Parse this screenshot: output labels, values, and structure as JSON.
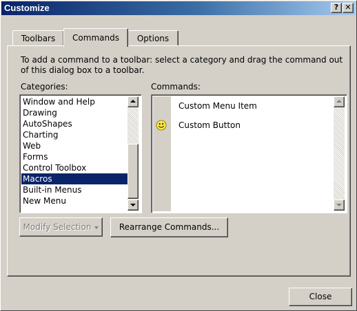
{
  "window": {
    "title": "Customize"
  },
  "titlebar_buttons": {
    "help": "?",
    "close": "✕"
  },
  "tabs": [
    {
      "label": "Toolbars",
      "selected": false
    },
    {
      "label": "Commands",
      "selected": true
    },
    {
      "label": "Options",
      "selected": false
    }
  ],
  "instructions": "To add a command to a toolbar: select a category and drag the command out of this dialog box to a toolbar.",
  "categories": {
    "label": "Categories:",
    "selected": "Macros",
    "items": [
      "Window and Help",
      "Drawing",
      "AutoShapes",
      "Charting",
      "Web",
      "Forms",
      "Control Toolbox",
      "Macros",
      "Built-in Menus",
      "New Menu"
    ]
  },
  "commands": {
    "label": "Commands:",
    "items": [
      {
        "label": "Custom Menu Item",
        "icon": "none"
      },
      {
        "label": "Custom Button",
        "icon": "smiley-face-icon"
      }
    ]
  },
  "buttons": {
    "modify_selection": "Modify Selection",
    "rearrange_commands": "Rearrange Commands...",
    "close": "Close"
  },
  "colors": {
    "selection": "#0a246a",
    "title_start": "#0a246a",
    "title_end": "#a6caf0",
    "face": "#d4d0c8",
    "smiley": "#ffe93b"
  }
}
